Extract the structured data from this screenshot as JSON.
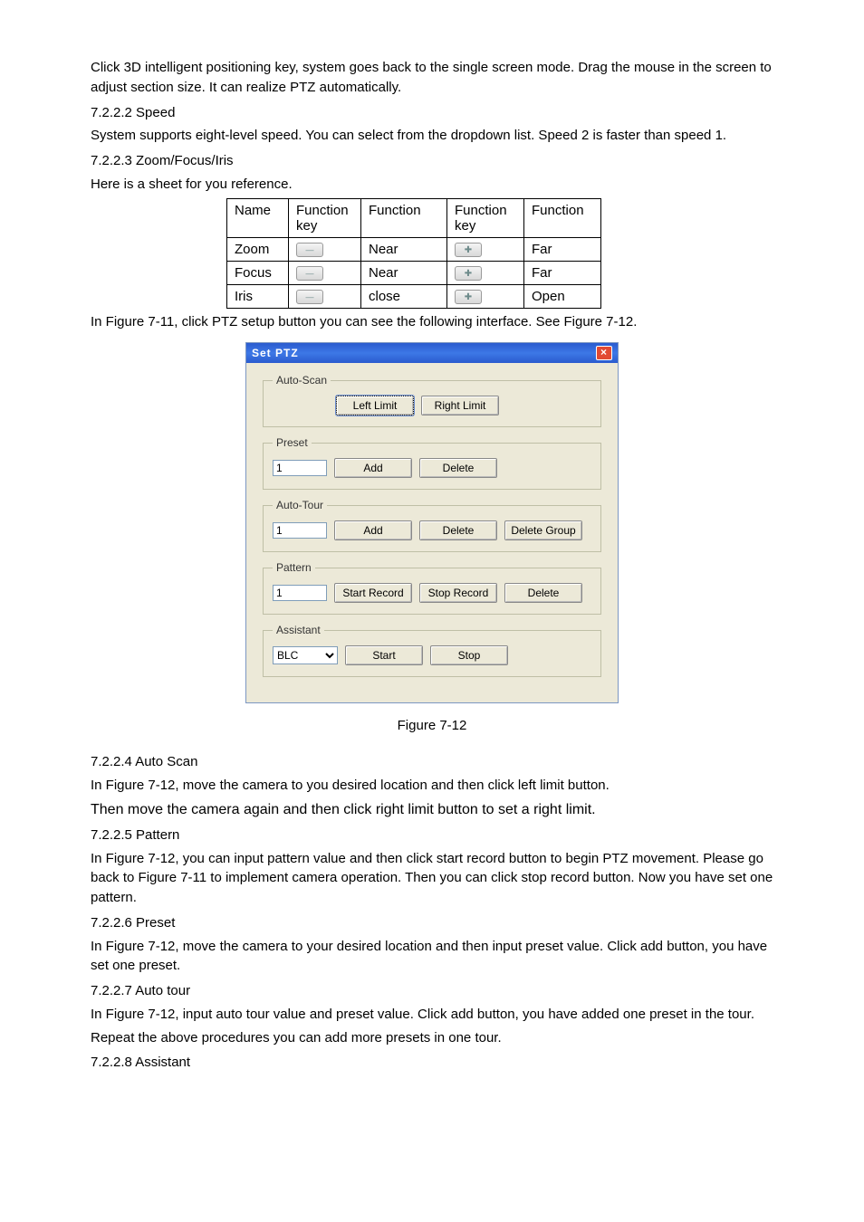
{
  "intro": {
    "p1": "Click 3D intelligent positioning key, system goes back to the single screen mode. Drag the mouse in the screen to adjust section size. It can realize PTZ automatically.",
    "h_speed": "7.2.2.2  Speed",
    "p_speed": "System supports eight-level speed. You can select from the dropdown list. Speed 2 is faster than speed 1.",
    "h_zfi": "7.2.2.3  Zoom/Focus/Iris",
    "p_zfi": "Here is a sheet for you reference."
  },
  "table": {
    "h1": "Name",
    "h2": "Function key",
    "h3": "Function",
    "h4": "Function key",
    "h5": "Function",
    "r1": {
      "name": "Zoom",
      "f1": "Near",
      "f2": "Far"
    },
    "r2": {
      "name": "Focus",
      "f1": "Near",
      "f2": "Far"
    },
    "r3": {
      "name": "Iris",
      "f1": "close",
      "f2": "Open"
    }
  },
  "after_table": "In Figure 7-11, click PTZ setup button you can see the following interface. See Figure 7-12.",
  "dlg": {
    "title": "Set PTZ",
    "autoscan": {
      "legend": "Auto-Scan",
      "left": "Left Limit",
      "right": "Right Limit"
    },
    "preset": {
      "legend": "Preset",
      "value": "1",
      "add": "Add",
      "del": "Delete"
    },
    "autotour": {
      "legend": "Auto-Tour",
      "value": "1",
      "add": "Add",
      "del": "Delete",
      "delgrp": "Delete Group"
    },
    "pattern": {
      "legend": "Pattern",
      "value": "1",
      "start": "Start Record",
      "stop": "Stop Record",
      "del": "Delete"
    },
    "assistant": {
      "legend": "Assistant",
      "option": "BLC",
      "start": "Start",
      "stop": "Stop"
    }
  },
  "figcap": "Figure 7-12",
  "s_autoscan": {
    "h": "7.2.2.4  Auto Scan",
    "p1": "In Figure 7-12, move the camera to you desired location and then click left limit button.",
    "p2": "Then move the camera again and then click right limit button to set a right limit."
  },
  "s_pattern": {
    "h": "7.2.2.5  Pattern",
    "p": "In Figure 7-12, you can input pattern value and then click start record button to begin PTZ movement. Please go back to Figure 7-11 to implement camera operation. Then you can click stop record button. Now you have set one pattern."
  },
  "s_preset": {
    "h": "7.2.2.6  Preset",
    "p": "In Figure 7-12, move the camera to your desired location and then input preset value. Click add button, you have set one preset."
  },
  "s_autotour": {
    "h": "7.2.2.7  Auto tour",
    "p1": "In Figure 7-12, input auto tour value and preset value. Click add button, you have added one preset in the tour.",
    "p2": "Repeat the above procedures you can add more presets in one tour."
  },
  "s_assistant": {
    "h": "7.2.2.8  Assistant"
  }
}
